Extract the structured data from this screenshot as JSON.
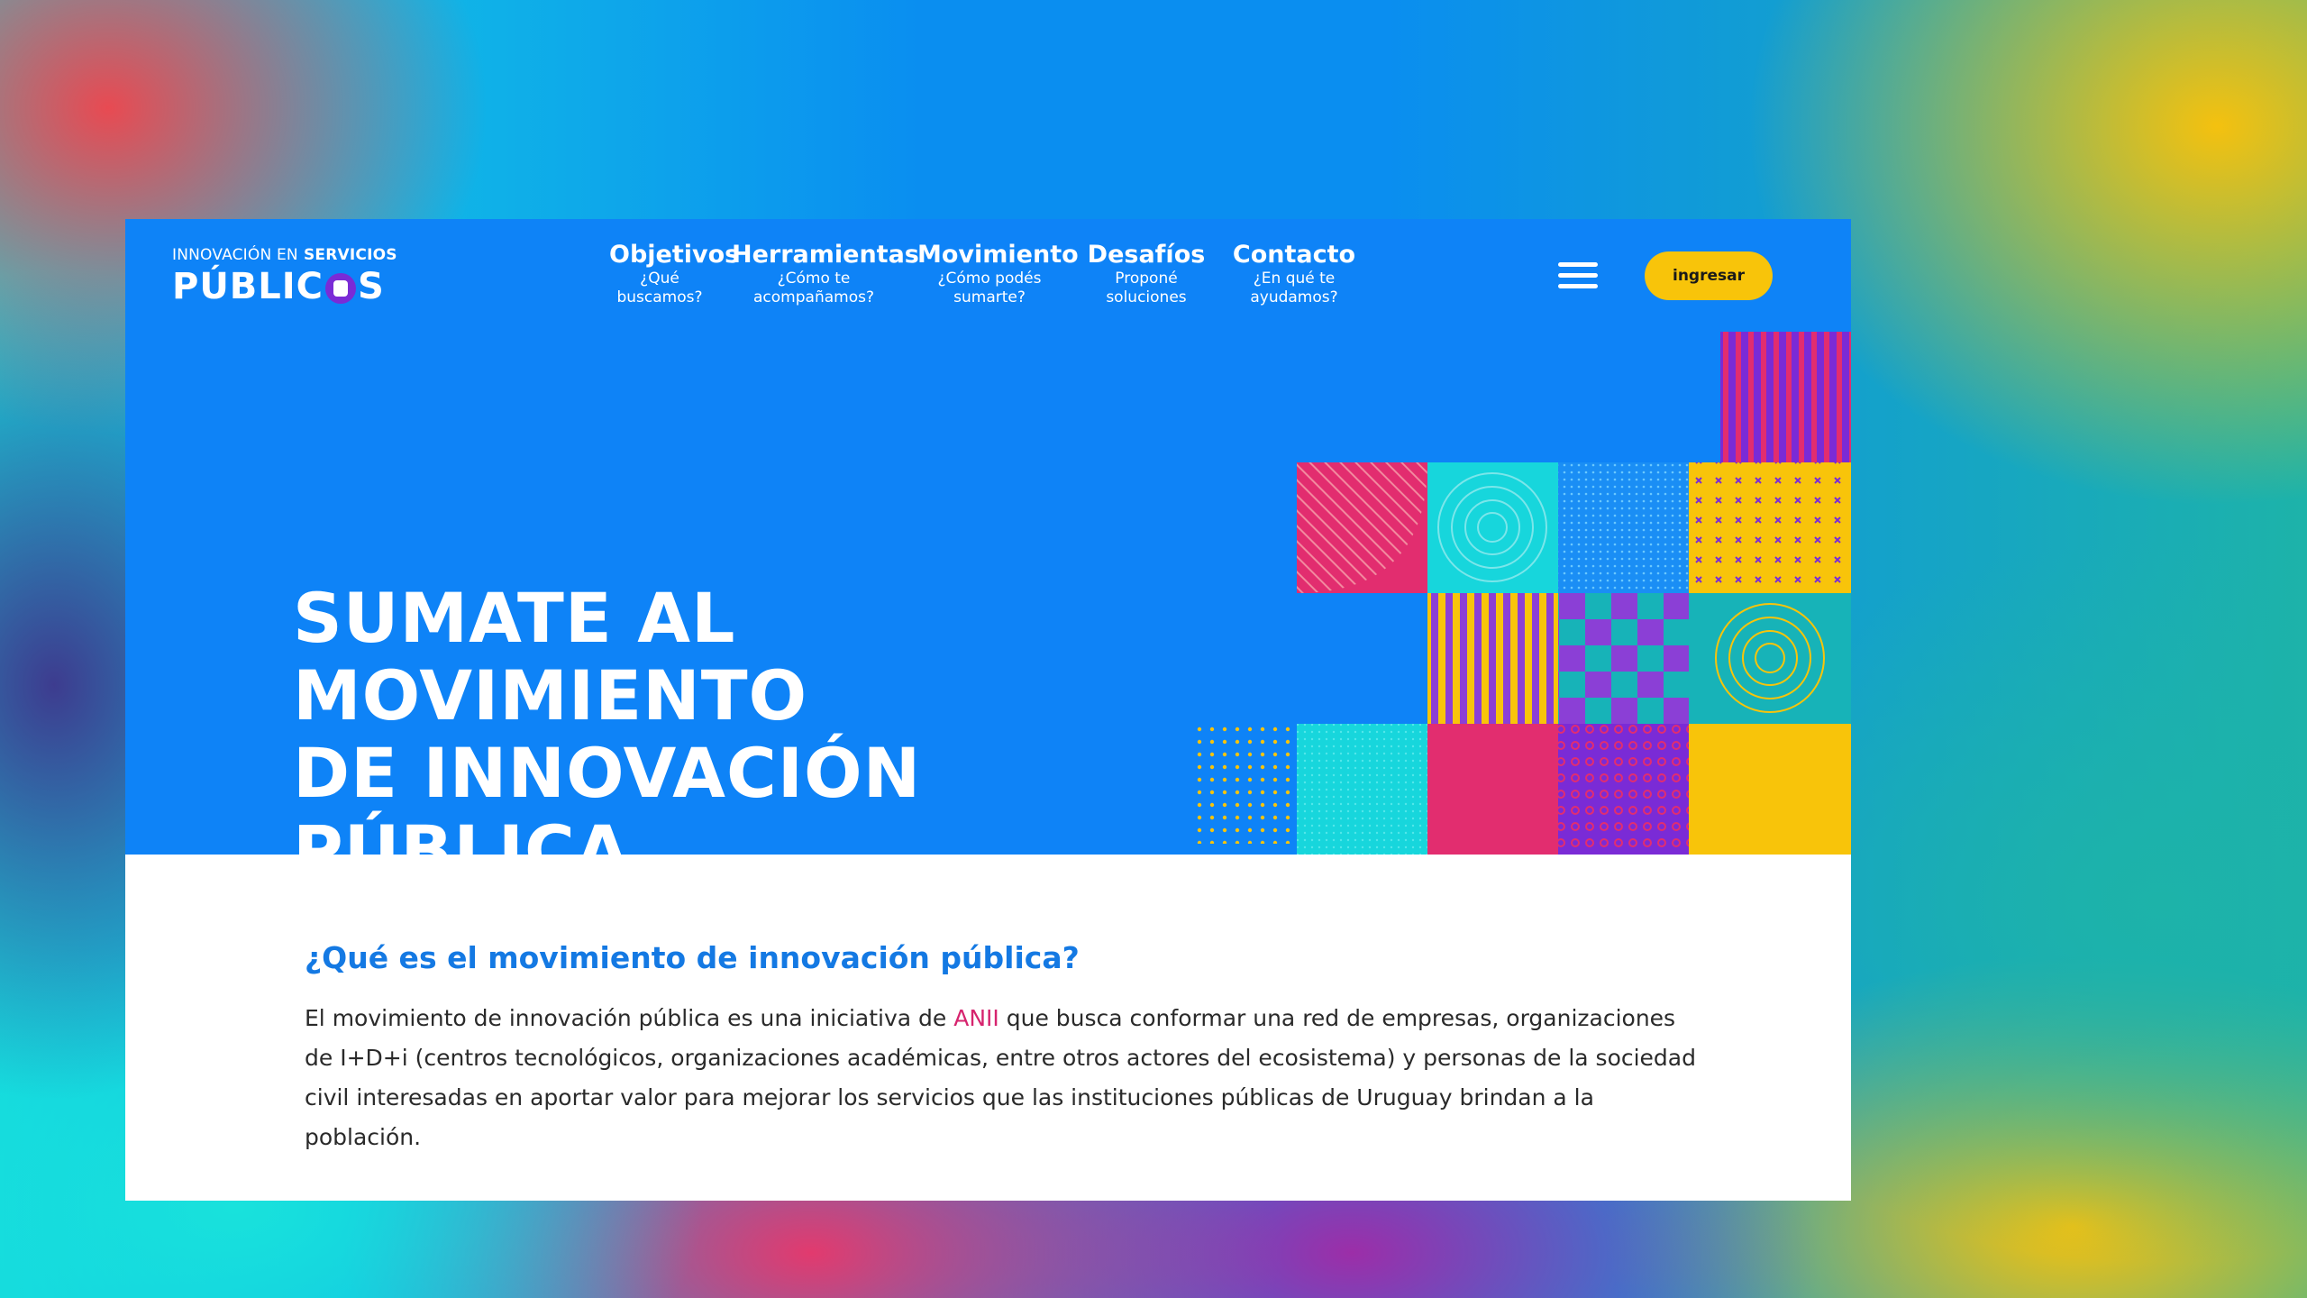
{
  "logo": {
    "top_text_plain": "INNOVACIÓN EN",
    "top_text_bold": "SERVICIOS",
    "bottom_left": "PÚBLIC",
    "bottom_right": "S"
  },
  "nav": {
    "items": [
      {
        "title": "Objetivos",
        "sub1": "¿Qué",
        "sub2": "buscamos?"
      },
      {
        "title": "Herramientas",
        "sub1": "¿Cómo te",
        "sub2": "acompañamos?"
      },
      {
        "title": "Movimiento",
        "sub1": "¿Cómo podés",
        "sub2": "sumarte?"
      },
      {
        "title": "Desafíos",
        "sub1": "Proponé",
        "sub2": "soluciones"
      },
      {
        "title": "Contacto",
        "sub1": "¿En qué te",
        "sub2": "ayudamos?"
      }
    ],
    "login_label": "ingresar"
  },
  "hero": {
    "line1": "SUMATE AL MOVIMIENTO",
    "line2": "DE INNOVACIÓN",
    "line3": "PÚBLICA"
  },
  "section": {
    "title": "¿Qué es el movimiento de innovación pública?",
    "body_before": "El movimiento de innovación pública es una iniciativa de ",
    "body_link": "ANII",
    "body_after": " que busca conformar una red de empresas, organizaciones de I+D+i (centros tecnológicos, organizaciones académicas, entre otros actores del ecosistema)  y personas de la sociedad civil interesadas en aportar valor para mejorar los servicios que las instituciones públicas de Uruguay brindan a la población."
  },
  "colors": {
    "hero_blue": "#0e83f7",
    "button_yellow": "#f8c40a",
    "title_blue": "#1479e3",
    "link_pink": "#d6246e",
    "mosaic_purple": "#7a2bd6",
    "mosaic_pink": "#e22d6f",
    "mosaic_cyan": "#17d6dc",
    "mosaic_yellow": "#f8c40a"
  }
}
